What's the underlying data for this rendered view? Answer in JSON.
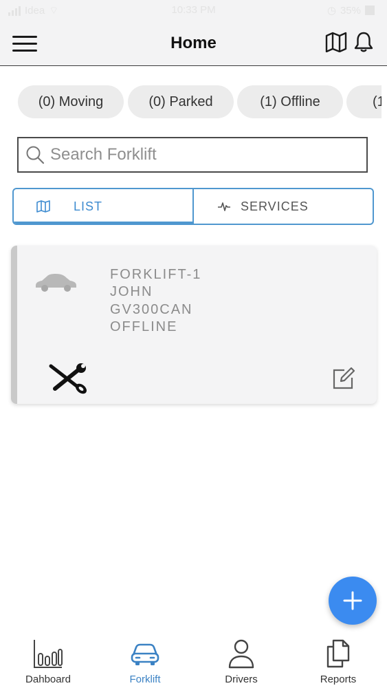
{
  "status_bar": {
    "carrier": "Idea",
    "time": "10:33 PM",
    "battery": "35%"
  },
  "header": {
    "title": "Home",
    "menu_icon": "hamburger-menu-icon",
    "map_icon": "map-icon",
    "notification_icon": "bell-icon"
  },
  "filters": {
    "chips": [
      {
        "label": "(0) Moving"
      },
      {
        "label": "(0) Parked"
      },
      {
        "label": "(1) Offline"
      },
      {
        "label": "(1"
      }
    ]
  },
  "search": {
    "placeholder": "Search Forklift",
    "value": ""
  },
  "tabs": {
    "list_label": "LIST",
    "services_label": "SERVICES",
    "active": "LIST"
  },
  "forklifts": [
    {
      "name": "FORKLIFT-1",
      "driver": "JOHN",
      "device": "GV300CAN",
      "status": "OFFLINE"
    }
  ],
  "bottom_nav": {
    "items": [
      {
        "label": "Dahboard",
        "icon": "bar-chart-icon"
      },
      {
        "label": "Forklift",
        "icon": "car-icon"
      },
      {
        "label": "Drivers",
        "icon": "person-icon"
      },
      {
        "label": "Reports",
        "icon": "documents-icon"
      }
    ],
    "active": "Forklift"
  },
  "colors": {
    "accent": "#3b8bf0",
    "tab_border": "#4f97cf",
    "nav_active": "#3b82c4",
    "card_border": "#c9c9c9"
  }
}
